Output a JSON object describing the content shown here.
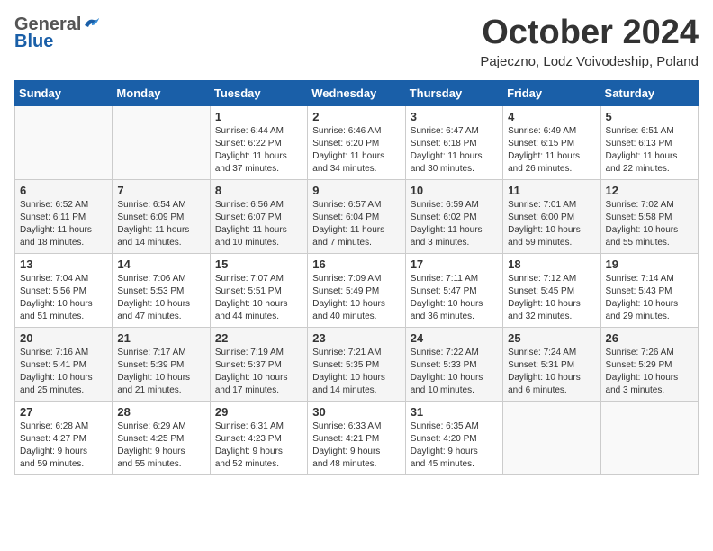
{
  "header": {
    "logo_general": "General",
    "logo_blue": "Blue",
    "month_title": "October 2024",
    "location": "Pajeczno, Lodz Voivodeship, Poland"
  },
  "days_of_week": [
    "Sunday",
    "Monday",
    "Tuesday",
    "Wednesday",
    "Thursday",
    "Friday",
    "Saturday"
  ],
  "weeks": [
    [
      {
        "day": "",
        "info": ""
      },
      {
        "day": "",
        "info": ""
      },
      {
        "day": "1",
        "info": "Sunrise: 6:44 AM\nSunset: 6:22 PM\nDaylight: 11 hours\nand 37 minutes."
      },
      {
        "day": "2",
        "info": "Sunrise: 6:46 AM\nSunset: 6:20 PM\nDaylight: 11 hours\nand 34 minutes."
      },
      {
        "day": "3",
        "info": "Sunrise: 6:47 AM\nSunset: 6:18 PM\nDaylight: 11 hours\nand 30 minutes."
      },
      {
        "day": "4",
        "info": "Sunrise: 6:49 AM\nSunset: 6:15 PM\nDaylight: 11 hours\nand 26 minutes."
      },
      {
        "day": "5",
        "info": "Sunrise: 6:51 AM\nSunset: 6:13 PM\nDaylight: 11 hours\nand 22 minutes."
      }
    ],
    [
      {
        "day": "6",
        "info": "Sunrise: 6:52 AM\nSunset: 6:11 PM\nDaylight: 11 hours\nand 18 minutes."
      },
      {
        "day": "7",
        "info": "Sunrise: 6:54 AM\nSunset: 6:09 PM\nDaylight: 11 hours\nand 14 minutes."
      },
      {
        "day": "8",
        "info": "Sunrise: 6:56 AM\nSunset: 6:07 PM\nDaylight: 11 hours\nand 10 minutes."
      },
      {
        "day": "9",
        "info": "Sunrise: 6:57 AM\nSunset: 6:04 PM\nDaylight: 11 hours\nand 7 minutes."
      },
      {
        "day": "10",
        "info": "Sunrise: 6:59 AM\nSunset: 6:02 PM\nDaylight: 11 hours\nand 3 minutes."
      },
      {
        "day": "11",
        "info": "Sunrise: 7:01 AM\nSunset: 6:00 PM\nDaylight: 10 hours\nand 59 minutes."
      },
      {
        "day": "12",
        "info": "Sunrise: 7:02 AM\nSunset: 5:58 PM\nDaylight: 10 hours\nand 55 minutes."
      }
    ],
    [
      {
        "day": "13",
        "info": "Sunrise: 7:04 AM\nSunset: 5:56 PM\nDaylight: 10 hours\nand 51 minutes."
      },
      {
        "day": "14",
        "info": "Sunrise: 7:06 AM\nSunset: 5:53 PM\nDaylight: 10 hours\nand 47 minutes."
      },
      {
        "day": "15",
        "info": "Sunrise: 7:07 AM\nSunset: 5:51 PM\nDaylight: 10 hours\nand 44 minutes."
      },
      {
        "day": "16",
        "info": "Sunrise: 7:09 AM\nSunset: 5:49 PM\nDaylight: 10 hours\nand 40 minutes."
      },
      {
        "day": "17",
        "info": "Sunrise: 7:11 AM\nSunset: 5:47 PM\nDaylight: 10 hours\nand 36 minutes."
      },
      {
        "day": "18",
        "info": "Sunrise: 7:12 AM\nSunset: 5:45 PM\nDaylight: 10 hours\nand 32 minutes."
      },
      {
        "day": "19",
        "info": "Sunrise: 7:14 AM\nSunset: 5:43 PM\nDaylight: 10 hours\nand 29 minutes."
      }
    ],
    [
      {
        "day": "20",
        "info": "Sunrise: 7:16 AM\nSunset: 5:41 PM\nDaylight: 10 hours\nand 25 minutes."
      },
      {
        "day": "21",
        "info": "Sunrise: 7:17 AM\nSunset: 5:39 PM\nDaylight: 10 hours\nand 21 minutes."
      },
      {
        "day": "22",
        "info": "Sunrise: 7:19 AM\nSunset: 5:37 PM\nDaylight: 10 hours\nand 17 minutes."
      },
      {
        "day": "23",
        "info": "Sunrise: 7:21 AM\nSunset: 5:35 PM\nDaylight: 10 hours\nand 14 minutes."
      },
      {
        "day": "24",
        "info": "Sunrise: 7:22 AM\nSunset: 5:33 PM\nDaylight: 10 hours\nand 10 minutes."
      },
      {
        "day": "25",
        "info": "Sunrise: 7:24 AM\nSunset: 5:31 PM\nDaylight: 10 hours\nand 6 minutes."
      },
      {
        "day": "26",
        "info": "Sunrise: 7:26 AM\nSunset: 5:29 PM\nDaylight: 10 hours\nand 3 minutes."
      }
    ],
    [
      {
        "day": "27",
        "info": "Sunrise: 6:28 AM\nSunset: 4:27 PM\nDaylight: 9 hours\nand 59 minutes."
      },
      {
        "day": "28",
        "info": "Sunrise: 6:29 AM\nSunset: 4:25 PM\nDaylight: 9 hours\nand 55 minutes."
      },
      {
        "day": "29",
        "info": "Sunrise: 6:31 AM\nSunset: 4:23 PM\nDaylight: 9 hours\nand 52 minutes."
      },
      {
        "day": "30",
        "info": "Sunrise: 6:33 AM\nSunset: 4:21 PM\nDaylight: 9 hours\nand 48 minutes."
      },
      {
        "day": "31",
        "info": "Sunrise: 6:35 AM\nSunset: 4:20 PM\nDaylight: 9 hours\nand 45 minutes."
      },
      {
        "day": "",
        "info": ""
      },
      {
        "day": "",
        "info": ""
      }
    ]
  ]
}
